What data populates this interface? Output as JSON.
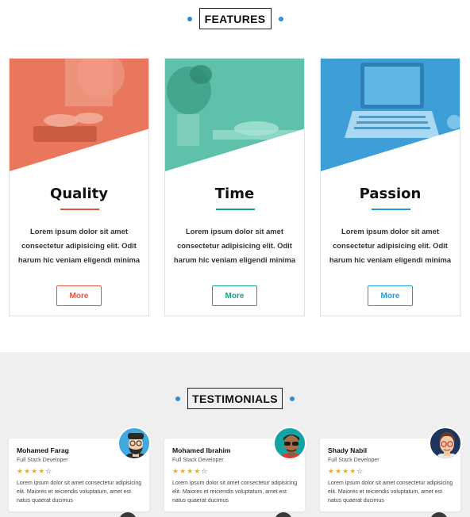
{
  "features": {
    "heading": "FEATURES",
    "cards": [
      {
        "title": "Quality",
        "accent": "#e0533d",
        "photo_tint": "#e8775e",
        "desc_lines": [
          "Lorem ipsum dolor sit amet",
          "consectetur adipisicing elit. Odit",
          "harum hic veniam eligendi minima"
        ],
        "button": "More"
      },
      {
        "title": "Time",
        "accent": "#17a38b",
        "photo_tint": "#5fc0ab",
        "desc_lines": [
          "Lorem ipsum dolor sit amet",
          "consectetur adipisicing elit. Odit",
          "harum hic veniam eligendi minima"
        ],
        "button": "More"
      },
      {
        "title": "Passion",
        "accent": "#1f9ad6",
        "photo_tint": "#3d9ed8",
        "desc_lines": [
          "Lorem ipsum dolor sit amet",
          "consectetur adipisicing elit. Odit",
          "harum hic veniam eligendi minima"
        ],
        "button": "More"
      }
    ]
  },
  "testimonials": {
    "heading": "TESTIMONIALS",
    "items": [
      {
        "name": "Mohamed Farag",
        "role": "Full Stack Developer",
        "stars": 4,
        "max_stars": 5,
        "quote": "Lorem ipsum dolor sit amet consectetur adipisicing elit. Maiores et reiciendis voluptatum, amet est natus quaerat ducimus",
        "avatar": "bearded-man-avatar",
        "avatar_bg": "#3fa9e0"
      },
      {
        "name": "Mohamed Ibrahim",
        "role": "Full Stack Developer",
        "stars": 4,
        "max_stars": 5,
        "quote": "Lorem ipsum dolor sit amet consectetur adipisicing elit. Maiores et reiciendis voluptatum, amet est natus quaerat ducimus",
        "avatar": "sunglasses-man-avatar",
        "avatar_bg": "#16a3a3"
      },
      {
        "name": "Shady Nabil",
        "role": "Full Stack Developer",
        "stars": 4,
        "max_stars": 5,
        "quote": "Lorem ipsum dolor sit amet consectetur adipisicing elit. Maiores et reiciendis voluptatum, amet est natus quaerat ducimus",
        "avatar": "glasses-man-avatar",
        "avatar_bg": "#1f3560"
      }
    ]
  },
  "colors": {
    "dot_blue": "#2b8fd6",
    "star": "#f2b400",
    "testimonial_bg": "#efefef"
  }
}
